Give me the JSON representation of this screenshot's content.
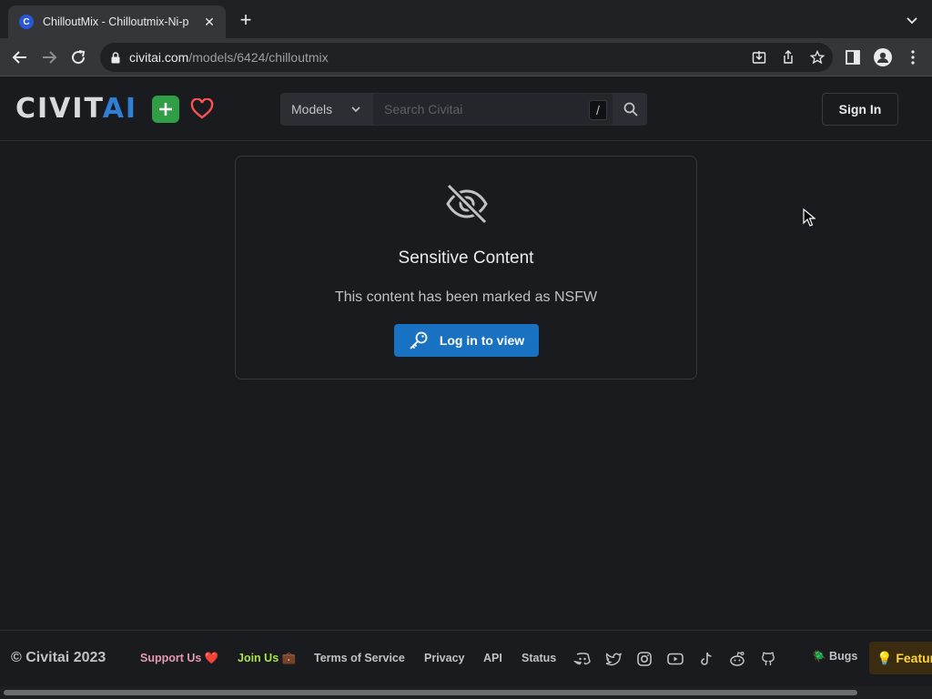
{
  "browser": {
    "tab": {
      "title": "ChilloutMix - Chilloutmix-Ni-p",
      "favicon_letter": "C"
    },
    "url": {
      "host": "civitai.com",
      "path": "/models/6424/chilloutmix"
    }
  },
  "header": {
    "logo": {
      "civ": "CIVIT",
      "ai": "AI"
    },
    "search": {
      "category": "Models",
      "placeholder": "Search Civitai",
      "shortcut": "/"
    },
    "signin_label": "Sign In"
  },
  "card": {
    "title": "Sensitive Content",
    "message": "This content has been marked as NSFW",
    "button_label": "Log in to view"
  },
  "footer": {
    "copyright": "© Civitai 2023",
    "links": {
      "support": "Support Us ❤️",
      "join": "Join Us 💼",
      "terms": "Terms of Service",
      "privacy": "Privacy",
      "api": "API",
      "status": "Status"
    },
    "bugs": "🪲 Bugs",
    "feature": "💡 Feature"
  },
  "colors": {
    "accent": "#1971c2",
    "background": "#1a1b1e",
    "create": "#2f9e44",
    "heart": "#fa5252"
  }
}
